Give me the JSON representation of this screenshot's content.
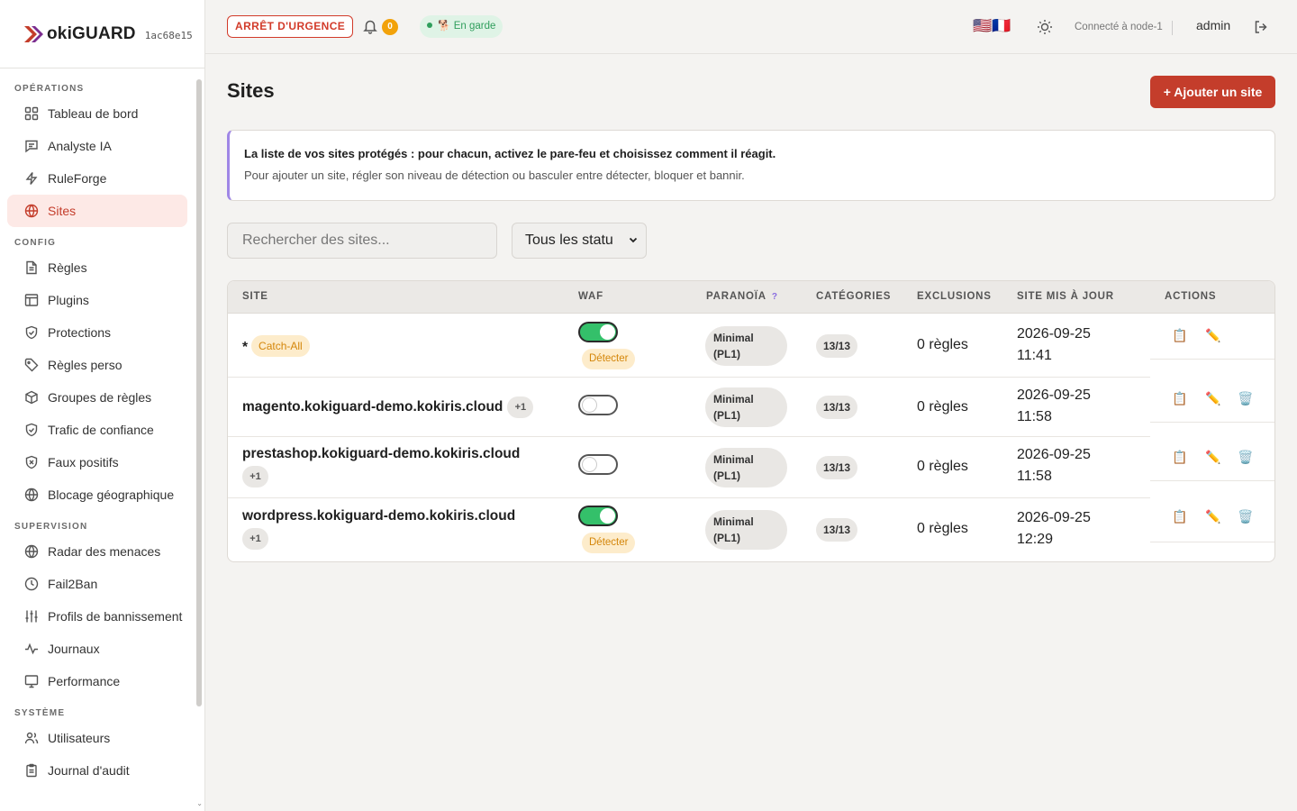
{
  "brand": {
    "name": "okiGUARD",
    "hash": "1ac68e15"
  },
  "nav": {
    "sections": [
      {
        "title": "OPÉRATIONS",
        "items": [
          "Tableau de bord",
          "Analyste IA",
          "RuleForge",
          "Sites"
        ]
      },
      {
        "title": "CONFIG",
        "items": [
          "Règles",
          "Plugins",
          "Protections",
          "Règles perso",
          "Groupes de règles",
          "Trafic de confiance",
          "Faux positifs",
          "Blocage géographique"
        ]
      },
      {
        "title": "SUPERVISION",
        "items": [
          "Radar des menaces",
          "Fail2Ban",
          "Profils de bannissement",
          "Journaux",
          "Performance"
        ]
      },
      {
        "title": "SYSTÈME",
        "items": [
          "Utilisateurs",
          "Journal d'audit"
        ]
      }
    ],
    "active": "Sites"
  },
  "topbar": {
    "emergency": "ARRÊT D'URGENCE",
    "notifications": "0",
    "guard_status": "En garde",
    "guard_emoji": "🐕",
    "flags": "🇺🇸🇫🇷",
    "connected": "Connecté à node-1",
    "user": "admin"
  },
  "page": {
    "title": "Sites",
    "add_button": "+ Ajouter un site",
    "info_title": "La liste de vos sites protégés : pour chacun, activez le pare-feu et choisissez comment il réagit.",
    "info_sub": "Pour ajouter un site, régler son niveau de détection ou basculer entre détecter, bloquer et bannir.",
    "search_placeholder": "Rechercher des sites...",
    "filter_value": "Tous les statu"
  },
  "table": {
    "headers": {
      "site": "SITE",
      "waf": "WAF",
      "paranoia": "PARANOÏA",
      "paranoia_help": "?",
      "categories": "CATÉGORIES",
      "exclusions": "EXCLUSIONS",
      "updated": "SITE MIS À JOUR",
      "actions": "ACTIONS"
    },
    "rows": [
      {
        "site": "*",
        "tag": "Catch-All",
        "extra": "",
        "waf_on": true,
        "mode": "Détecter",
        "paranoia_1": "Minimal",
        "paranoia_2": "(PL1)",
        "categories": "13/13",
        "exclusions": "0 règles",
        "date": "2026-09-25",
        "time": "11:41",
        "deletable": false
      },
      {
        "site": "magento.kokiguard-demo.kokiris.cloud",
        "tag": "",
        "extra": "+1",
        "waf_on": false,
        "mode": "",
        "paranoia_1": "Minimal",
        "paranoia_2": "(PL1)",
        "categories": "13/13",
        "exclusions": "0 règles",
        "date": "2026-09-25",
        "time": "11:58",
        "deletable": true
      },
      {
        "site": "prestashop.kokiguard-demo.kokiris.cloud",
        "tag": "",
        "extra": "+1",
        "waf_on": false,
        "mode": "",
        "paranoia_1": "Minimal",
        "paranoia_2": "(PL1)",
        "categories": "13/13",
        "exclusions": "0 règles",
        "date": "2026-09-25",
        "time": "11:58",
        "deletable": true
      },
      {
        "site": "wordpress.kokiguard-demo.kokiris.cloud",
        "tag": "",
        "extra": "+1",
        "waf_on": true,
        "mode": "Détecter",
        "paranoia_1": "Minimal",
        "paranoia_2": "(PL1)",
        "categories": "13/13",
        "exclusions": "0 règles",
        "date": "2026-09-25",
        "time": "12:29",
        "deletable": true
      }
    ],
    "action_icons": {
      "copy": "📋",
      "edit": "✏️",
      "delete": "🗑️"
    }
  },
  "colors": {
    "accent": "#c43d2b",
    "waf_on": "#34c06a",
    "warning": "#d4860a",
    "info_border": "#9f86e6"
  }
}
